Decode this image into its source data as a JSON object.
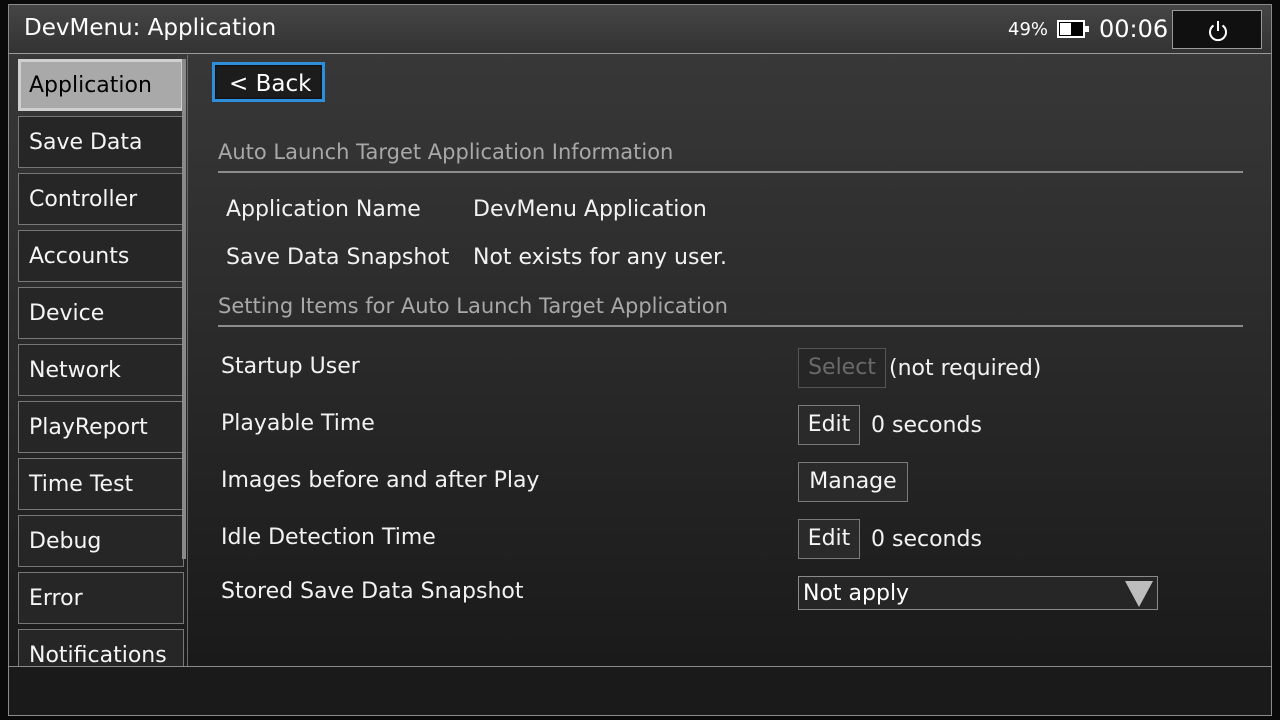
{
  "header": {
    "title": "DevMenu: Application",
    "battery_percent": "49%",
    "battery_level": 0.49,
    "battery_icon": "battery-icon",
    "time": "00:06",
    "power_icon": "power-icon"
  },
  "sidebar": {
    "active_index": 0,
    "items": [
      {
        "label": "Application"
      },
      {
        "label": "Save Data"
      },
      {
        "label": "Controller"
      },
      {
        "label": "Accounts"
      },
      {
        "label": "Device"
      },
      {
        "label": "Network"
      },
      {
        "label": "PlayReport"
      },
      {
        "label": "Time Test"
      },
      {
        "label": "Debug"
      },
      {
        "label": "Error"
      },
      {
        "label": "Notifications"
      }
    ]
  },
  "main": {
    "back_label": "< Back",
    "info_section": {
      "title": "Auto Launch Target Application Information",
      "rows": [
        {
          "label": "Application Name",
          "value": "DevMenu Application"
        },
        {
          "label": "Save Data Snapshot",
          "value": "Not exists for any user."
        }
      ]
    },
    "settings_section": {
      "title": "Setting Items for Auto Launch Target Application",
      "rows": [
        {
          "label": "Startup User",
          "button": "Select",
          "button_disabled": true,
          "value": "(not required)"
        },
        {
          "label": "Playable Time",
          "button": "Edit",
          "value": "0 seconds"
        },
        {
          "label": "Images before and after Play",
          "button": "Manage",
          "value": ""
        },
        {
          "label": "Idle Detection Time",
          "button": "Edit",
          "value": "0 seconds"
        },
        {
          "label": "Stored Save Data Snapshot",
          "dropdown_value": "Not apply",
          "dropdown_icon": "triangle-down-icon"
        }
      ]
    }
  },
  "colors": {
    "accent_focus": "#2d8fdc",
    "active_item_bg": "#a9a9a9",
    "section_header": "#a8a8a8"
  }
}
